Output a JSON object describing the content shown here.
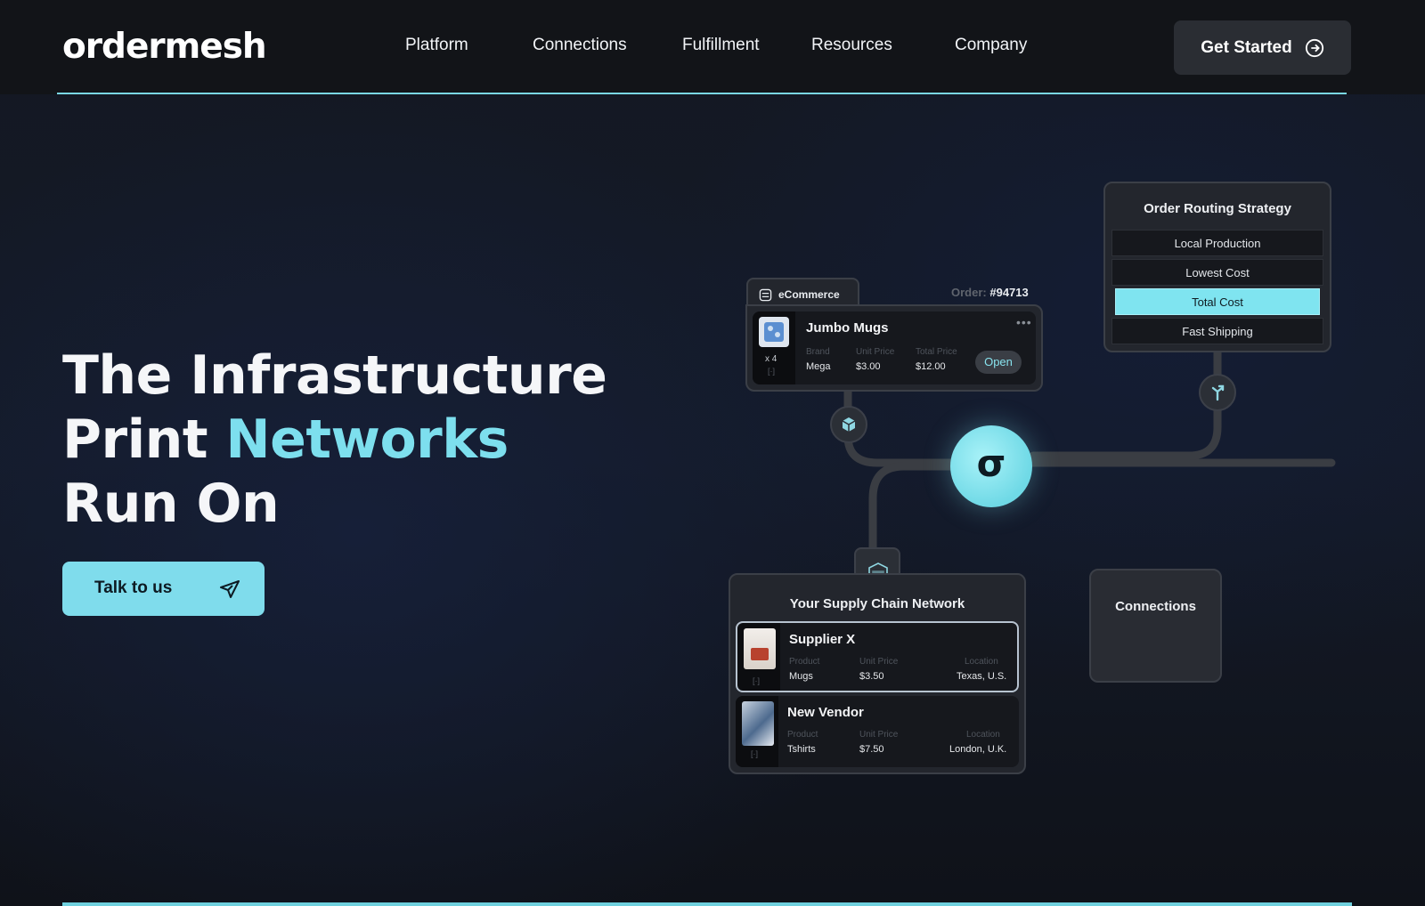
{
  "brand": {
    "logo_text": "ordermesh"
  },
  "nav": {
    "links": [
      "Platform",
      "Connections",
      "Fulfillment",
      "Resources",
      "Company"
    ],
    "cta_label": "Get Started"
  },
  "hero": {
    "line1": "The Infrastructure",
    "line2_prefix": "Print",
    "line2_accent": "Networks",
    "line3": "Run On",
    "button_label": "Talk to us"
  },
  "ecommerce_card": {
    "tab_label": "eCommerce",
    "order_prefix": "Order:",
    "order_number": "#94713",
    "product_name": "Jumbo Mugs",
    "quantity": "x 4",
    "more": "•••",
    "brand_label": "Brand",
    "brand_value": "Mega",
    "unit_price_label": "Unit Price",
    "unit_price_value": "$3.00",
    "total_price_label": "Total Price",
    "total_price_value": "$12.00",
    "status": "Open"
  },
  "routing": {
    "title": "Order Routing Strategy",
    "options": [
      "Local Production",
      "Lowest Cost",
      "Total Cost",
      "Fast Shipping"
    ],
    "selected": "Total Cost"
  },
  "hub": {
    "symbol": "σ"
  },
  "supply_chain": {
    "title": "Your Supply Chain Network",
    "vendors": [
      {
        "name": "Supplier X",
        "product_label": "Product",
        "product_value": "Mugs",
        "unit_price_label": "Unit Price",
        "unit_price_value": "$3.50",
        "location_label": "Location",
        "location_value": "Texas, U.S."
      },
      {
        "name": "New Vendor",
        "product_label": "Product",
        "product_value": "Tshirts",
        "unit_price_label": "Unit Price",
        "unit_price_value": "$7.50",
        "location_label": "Location",
        "location_value": "London, U.K."
      }
    ]
  },
  "connections_card": {
    "title": "Connections"
  },
  "colors": {
    "accent": "#7ddfee",
    "background": "#141822",
    "card": "#23262d"
  },
  "icons": [
    "arrow-right-circle-icon",
    "send-icon",
    "store-icon",
    "package-icon",
    "routing-icon",
    "warehouse-icon",
    "scan-icon"
  ]
}
